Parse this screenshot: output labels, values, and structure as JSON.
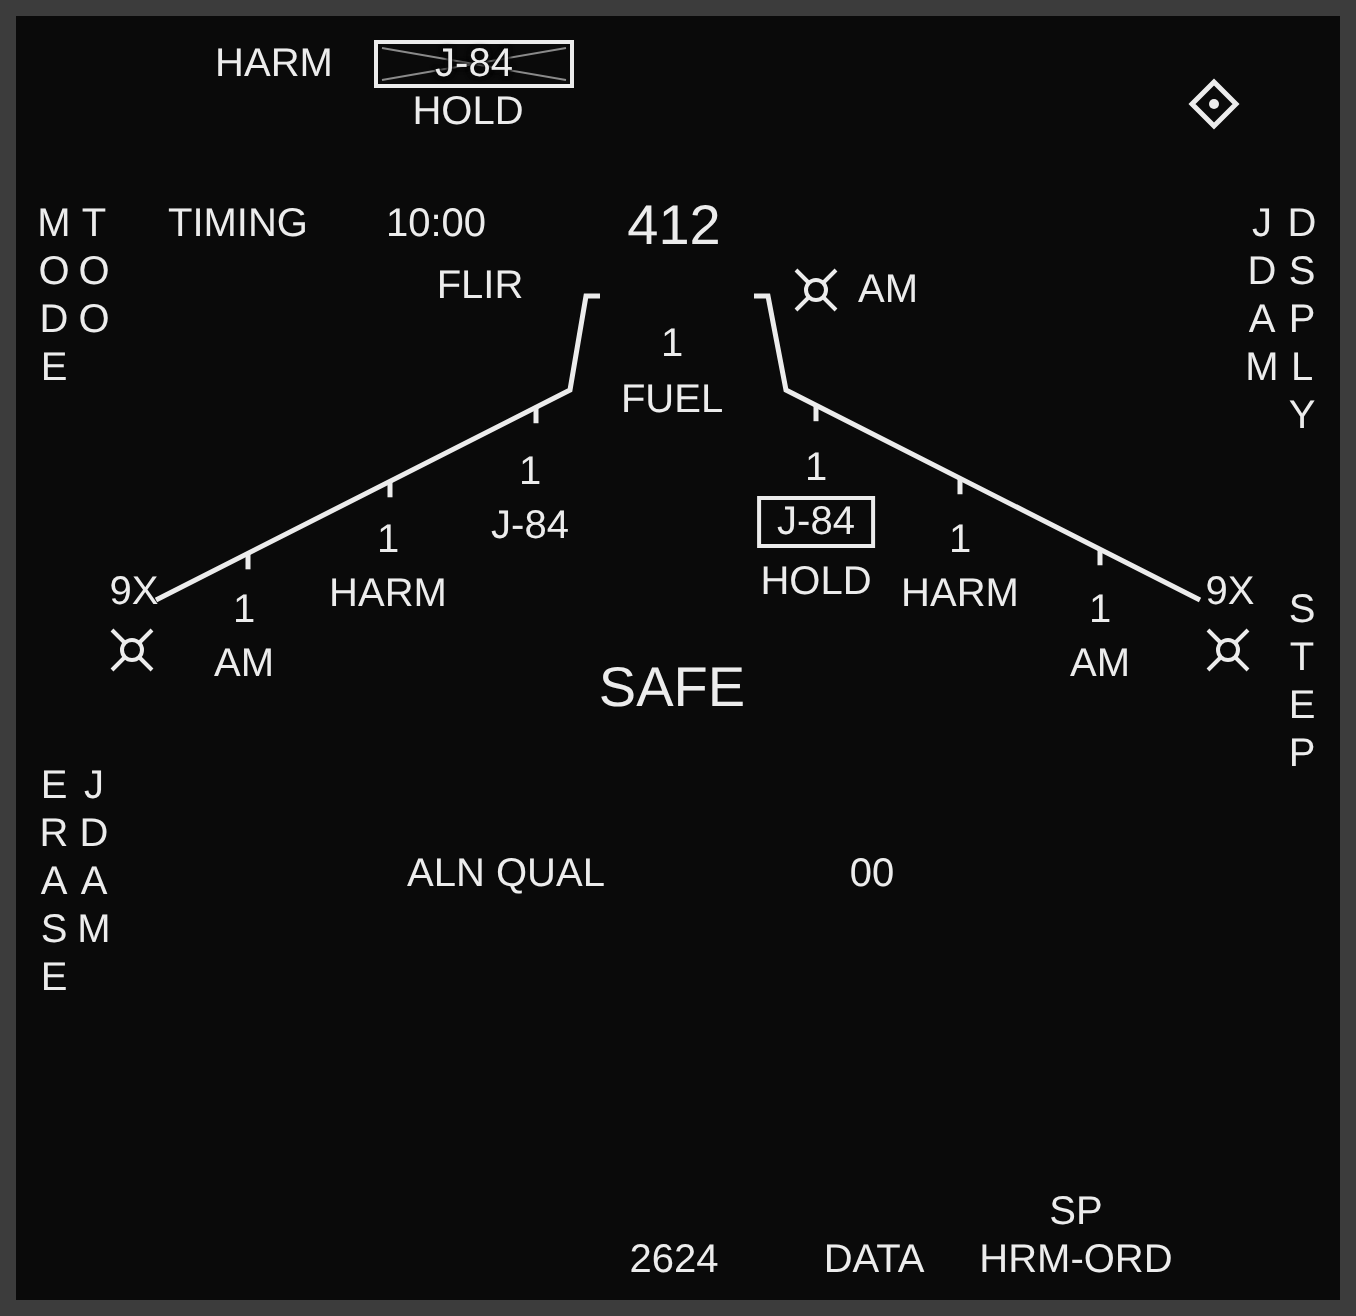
{
  "top": {
    "weapon": "HARM",
    "store": {
      "label": "J-84",
      "crossed": true
    },
    "status": "HOLD"
  },
  "header": {
    "timing_label": "TIMING",
    "timing": "10:00",
    "code": "412"
  },
  "nose": [
    {
      "kind": "plain",
      "store": "FLIR"
    },
    {
      "kind": "marked",
      "store": "AM"
    }
  ],
  "centerline": {
    "count": "1",
    "store": "FUEL"
  },
  "stations": [
    {
      "kind": "wingtip",
      "store": "9X"
    },
    {
      "kind": "pylon",
      "count": "1",
      "store": "AM",
      "selected": false
    },
    {
      "kind": "pylon",
      "count": "1",
      "store": "HARM",
      "selected": false
    },
    {
      "kind": "pylon",
      "count": "1",
      "store": "J-84",
      "selected": false
    },
    {
      "kind": "pylon",
      "count": "1",
      "store": "J-84",
      "selected": true,
      "status": "HOLD"
    },
    {
      "kind": "pylon",
      "count": "1",
      "store": "HARM",
      "selected": false
    },
    {
      "kind": "pylon",
      "count": "1",
      "store": "AM",
      "selected": false
    },
    {
      "kind": "wingtip",
      "store": "9X"
    }
  ],
  "master_arm": "SAFE",
  "alignment": {
    "label": "ALN QUAL",
    "value": "00"
  },
  "pushbuttons": {
    "left": [
      "MODE",
      "TOO",
      "ERASE",
      "JDAM"
    ],
    "right": [
      "JDAM",
      "DSPLY",
      "STEP"
    ],
    "bottom": [
      {
        "label": "2624"
      },
      {
        "label": "DATA"
      },
      {
        "label": "HRM-ORD",
        "caption": "SP"
      }
    ]
  }
}
